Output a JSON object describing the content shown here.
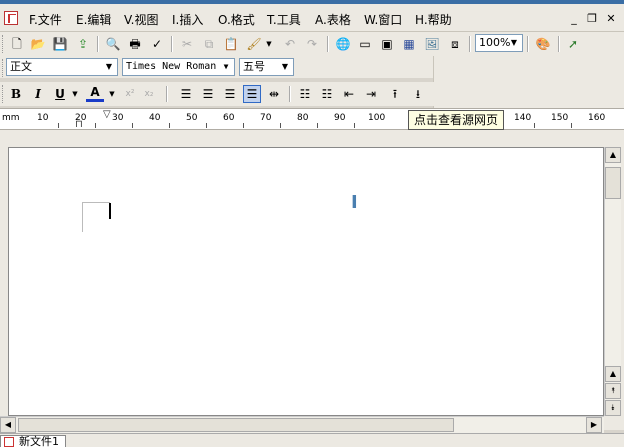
{
  "menubar": {
    "items": [
      {
        "label": "F.文件"
      },
      {
        "label": "E.编辑"
      },
      {
        "label": "V.视图"
      },
      {
        "label": "I.插入"
      },
      {
        "label": "O.格式"
      },
      {
        "label": "T.工具"
      },
      {
        "label": "A.表格"
      },
      {
        "label": "W.窗口"
      },
      {
        "label": "H.帮助"
      }
    ],
    "minimize": "_",
    "restore": "❐",
    "close": "✕"
  },
  "toolbar": {
    "zoom": "100%"
  },
  "format_bar": {
    "style": "正文",
    "font": "Times New Roman",
    "size": "五号",
    "bold": "B",
    "italic": "I",
    "underline": "U",
    "font_color": "A"
  },
  "ruler": {
    "unit": "mm",
    "labels": [
      "10",
      "20",
      "30",
      "40",
      "50",
      "60",
      "70",
      "80",
      "90",
      "100",
      "140",
      "150",
      "160"
    ]
  },
  "tooltip": {
    "text": "点击查看源网页"
  },
  "tabs": [
    {
      "label": "新文件1"
    }
  ],
  "colors": {
    "accent": "#316ac5",
    "font_color_bar": "#1a3cc8"
  }
}
